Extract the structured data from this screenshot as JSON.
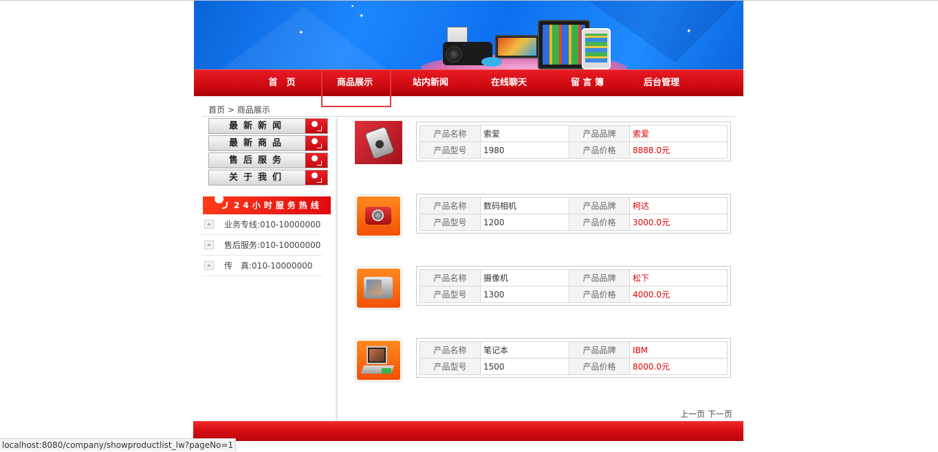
{
  "nav": {
    "items": [
      "首　页",
      "商品展示",
      "站内新闻",
      "在线聊天",
      "留 言 簿",
      "后台管理"
    ],
    "active_index": 1
  },
  "breadcrumb": {
    "home": "首页",
    "sep": ">",
    "current": "商品展示"
  },
  "sidebar": {
    "menu": [
      "最新新闻",
      "最新商品",
      "售后服务",
      "关于我们"
    ],
    "hotline_title": "24小时服务热线",
    "contacts": [
      "业务专线:010-10000000",
      "售后服务:010-10000000",
      "传　真:010-10000000"
    ]
  },
  "labels": {
    "name": "产品名称",
    "brand": "产品品牌",
    "model": "产品型号",
    "price": "产品价格"
  },
  "products": [
    {
      "name": "索爱",
      "brand": "索爱",
      "model": "1980",
      "price": "8888.0元"
    },
    {
      "name": "数码相机",
      "brand": "柯达",
      "model": "1200",
      "price": "3000.0元"
    },
    {
      "name": "摄像机",
      "brand": "松下",
      "model": "1300",
      "price": "4000.0元"
    },
    {
      "name": "笔记本",
      "brand": "IBM",
      "model": "1500",
      "price": "8000.0元"
    }
  ],
  "pager": {
    "prev": "上一页",
    "next": "下一页"
  },
  "status_url": "localhost:8080/company/showproductlist_lw?pageNo=1",
  "colors": {
    "nav_red": "#cf0a12",
    "price_red": "#dd0000",
    "banner_blue": "#1c86ff"
  }
}
